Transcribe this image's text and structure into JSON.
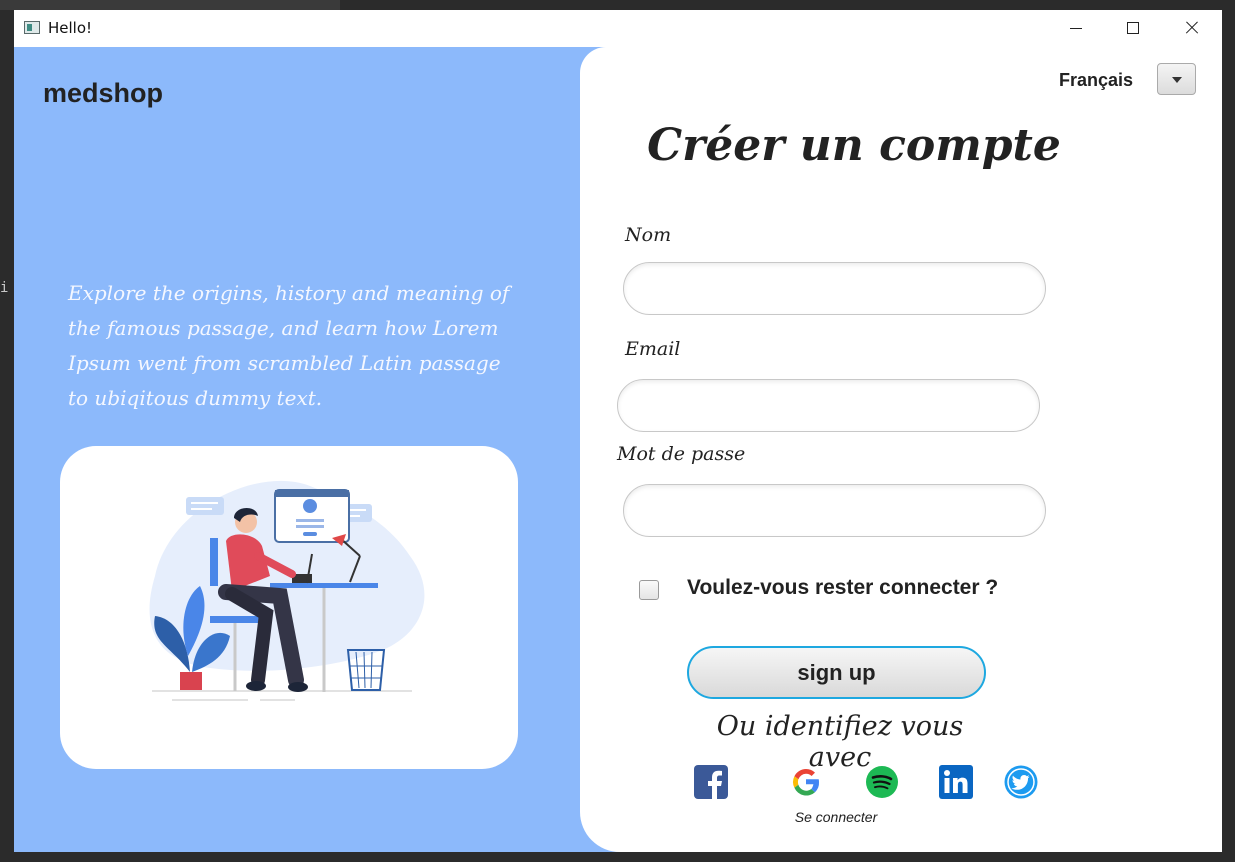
{
  "window": {
    "title": "Hello!"
  },
  "left": {
    "brand": "medshop",
    "tagline": "Explore the origins, history and meaning of the famous passage, and learn how Lorem Ipsum went from scrambled Latin passage to ubiqitous dummy text."
  },
  "language": {
    "selected": "Français"
  },
  "form": {
    "heading": "Créer un compte",
    "name_label": "Nom",
    "email_label": "Email",
    "password_label": "Mot de passe",
    "remember_label": "Voulez-vous rester connecter ?",
    "signup_label": "sign up",
    "or_label": "Ou identifiez vous avec",
    "social_caption": "Se connecter",
    "social_icons": [
      "facebook-icon",
      "google-icon",
      "spotify-icon",
      "linkedin-icon",
      "twitter-icon"
    ]
  },
  "colors": {
    "left_panel": "#8cb9fb",
    "accent_border": "#1ea8e0",
    "facebook": "#3b5998",
    "linkedin": "#0a66c2",
    "twitter": "#1d9bf0",
    "spotify": "#1db954"
  }
}
